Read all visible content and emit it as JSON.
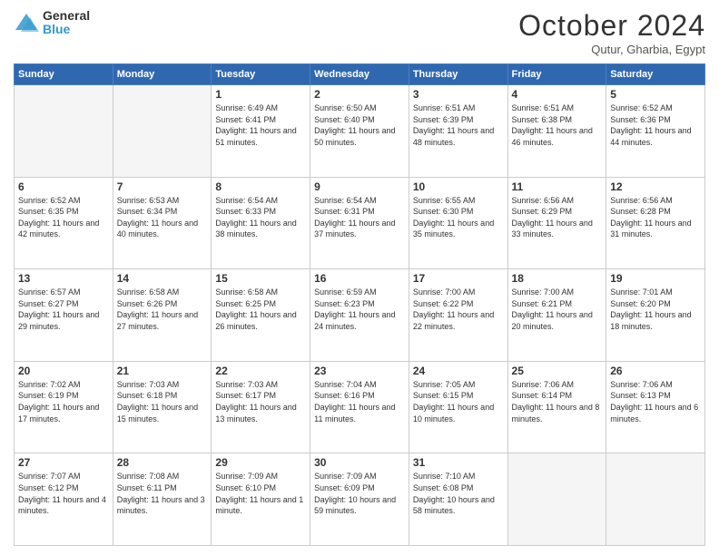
{
  "header": {
    "logo_general": "General",
    "logo_blue": "Blue",
    "month_title": "October 2024",
    "subtitle": "Qutur, Gharbia, Egypt"
  },
  "days_of_week": [
    "Sunday",
    "Monday",
    "Tuesday",
    "Wednesday",
    "Thursday",
    "Friday",
    "Saturday"
  ],
  "weeks": [
    [
      {
        "day": "",
        "info": ""
      },
      {
        "day": "",
        "info": ""
      },
      {
        "day": "1",
        "info": "Sunrise: 6:49 AM\nSunset: 6:41 PM\nDaylight: 11 hours and 51 minutes."
      },
      {
        "day": "2",
        "info": "Sunrise: 6:50 AM\nSunset: 6:40 PM\nDaylight: 11 hours and 50 minutes."
      },
      {
        "day": "3",
        "info": "Sunrise: 6:51 AM\nSunset: 6:39 PM\nDaylight: 11 hours and 48 minutes."
      },
      {
        "day": "4",
        "info": "Sunrise: 6:51 AM\nSunset: 6:38 PM\nDaylight: 11 hours and 46 minutes."
      },
      {
        "day": "5",
        "info": "Sunrise: 6:52 AM\nSunset: 6:36 PM\nDaylight: 11 hours and 44 minutes."
      }
    ],
    [
      {
        "day": "6",
        "info": "Sunrise: 6:52 AM\nSunset: 6:35 PM\nDaylight: 11 hours and 42 minutes."
      },
      {
        "day": "7",
        "info": "Sunrise: 6:53 AM\nSunset: 6:34 PM\nDaylight: 11 hours and 40 minutes."
      },
      {
        "day": "8",
        "info": "Sunrise: 6:54 AM\nSunset: 6:33 PM\nDaylight: 11 hours and 38 minutes."
      },
      {
        "day": "9",
        "info": "Sunrise: 6:54 AM\nSunset: 6:31 PM\nDaylight: 11 hours and 37 minutes."
      },
      {
        "day": "10",
        "info": "Sunrise: 6:55 AM\nSunset: 6:30 PM\nDaylight: 11 hours and 35 minutes."
      },
      {
        "day": "11",
        "info": "Sunrise: 6:56 AM\nSunset: 6:29 PM\nDaylight: 11 hours and 33 minutes."
      },
      {
        "day": "12",
        "info": "Sunrise: 6:56 AM\nSunset: 6:28 PM\nDaylight: 11 hours and 31 minutes."
      }
    ],
    [
      {
        "day": "13",
        "info": "Sunrise: 6:57 AM\nSunset: 6:27 PM\nDaylight: 11 hours and 29 minutes."
      },
      {
        "day": "14",
        "info": "Sunrise: 6:58 AM\nSunset: 6:26 PM\nDaylight: 11 hours and 27 minutes."
      },
      {
        "day": "15",
        "info": "Sunrise: 6:58 AM\nSunset: 6:25 PM\nDaylight: 11 hours and 26 minutes."
      },
      {
        "day": "16",
        "info": "Sunrise: 6:59 AM\nSunset: 6:23 PM\nDaylight: 11 hours and 24 minutes."
      },
      {
        "day": "17",
        "info": "Sunrise: 7:00 AM\nSunset: 6:22 PM\nDaylight: 11 hours and 22 minutes."
      },
      {
        "day": "18",
        "info": "Sunrise: 7:00 AM\nSunset: 6:21 PM\nDaylight: 11 hours and 20 minutes."
      },
      {
        "day": "19",
        "info": "Sunrise: 7:01 AM\nSunset: 6:20 PM\nDaylight: 11 hours and 18 minutes."
      }
    ],
    [
      {
        "day": "20",
        "info": "Sunrise: 7:02 AM\nSunset: 6:19 PM\nDaylight: 11 hours and 17 minutes."
      },
      {
        "day": "21",
        "info": "Sunrise: 7:03 AM\nSunset: 6:18 PM\nDaylight: 11 hours and 15 minutes."
      },
      {
        "day": "22",
        "info": "Sunrise: 7:03 AM\nSunset: 6:17 PM\nDaylight: 11 hours and 13 minutes."
      },
      {
        "day": "23",
        "info": "Sunrise: 7:04 AM\nSunset: 6:16 PM\nDaylight: 11 hours and 11 minutes."
      },
      {
        "day": "24",
        "info": "Sunrise: 7:05 AM\nSunset: 6:15 PM\nDaylight: 11 hours and 10 minutes."
      },
      {
        "day": "25",
        "info": "Sunrise: 7:06 AM\nSunset: 6:14 PM\nDaylight: 11 hours and 8 minutes."
      },
      {
        "day": "26",
        "info": "Sunrise: 7:06 AM\nSunset: 6:13 PM\nDaylight: 11 hours and 6 minutes."
      }
    ],
    [
      {
        "day": "27",
        "info": "Sunrise: 7:07 AM\nSunset: 6:12 PM\nDaylight: 11 hours and 4 minutes."
      },
      {
        "day": "28",
        "info": "Sunrise: 7:08 AM\nSunset: 6:11 PM\nDaylight: 11 hours and 3 minutes."
      },
      {
        "day": "29",
        "info": "Sunrise: 7:09 AM\nSunset: 6:10 PM\nDaylight: 11 hours and 1 minute."
      },
      {
        "day": "30",
        "info": "Sunrise: 7:09 AM\nSunset: 6:09 PM\nDaylight: 10 hours and 59 minutes."
      },
      {
        "day": "31",
        "info": "Sunrise: 7:10 AM\nSunset: 6:08 PM\nDaylight: 10 hours and 58 minutes."
      },
      {
        "day": "",
        "info": ""
      },
      {
        "day": "",
        "info": ""
      }
    ]
  ]
}
